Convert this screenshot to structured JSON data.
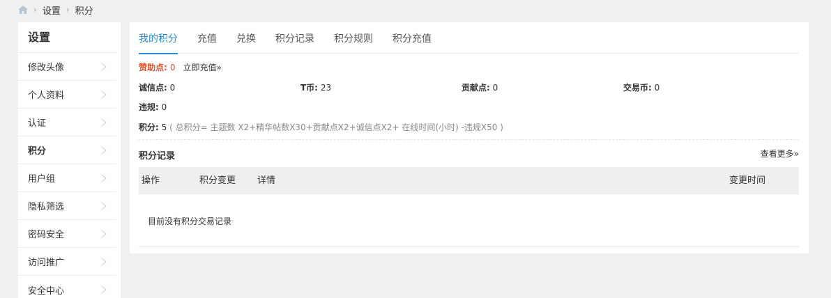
{
  "breadcrumb": {
    "items": [
      "设置",
      "积分"
    ]
  },
  "sidebar": {
    "title": "设置",
    "items": [
      {
        "label": "修改头像"
      },
      {
        "label": "个人资料"
      },
      {
        "label": "认证"
      },
      {
        "label": "积分"
      },
      {
        "label": "用户组"
      },
      {
        "label": "隐私筛选"
      },
      {
        "label": "密码安全"
      },
      {
        "label": "访问推广"
      },
      {
        "label": "安全中心"
      }
    ],
    "active_index": 3
  },
  "tabs": [
    "我的积分",
    "充值",
    "兑换",
    "积分记录",
    "积分规则",
    "积分充值"
  ],
  "credits": {
    "sponsor_label": "赞助点:",
    "sponsor_value": "0",
    "recharge_link": "立即充值»",
    "integrity_label": "诚信点:",
    "integrity_value": "0",
    "tcoin_label": "T币:",
    "tcoin_value": "23",
    "contribution_label": "贡献点:",
    "contribution_value": "0",
    "trade_label": "交易币:",
    "trade_value": "0",
    "violation_label": "违规:",
    "violation_value": "0",
    "total_label": "积分:",
    "total_value": "5",
    "formula": "( 总积分= 主题数 X2+精华帖数X30+贡献点X2+诚信点X2+ 在线时间(小时) -违规X50 )"
  },
  "records": {
    "title": "积分记录",
    "more": "查看更多»",
    "columns": [
      "操作",
      "积分变更",
      "详情",
      "变更时间"
    ],
    "empty": "目前没有积分交易记录"
  },
  "colors": {
    "accent": "#2a8ad4",
    "highlight": "#e0502a"
  }
}
